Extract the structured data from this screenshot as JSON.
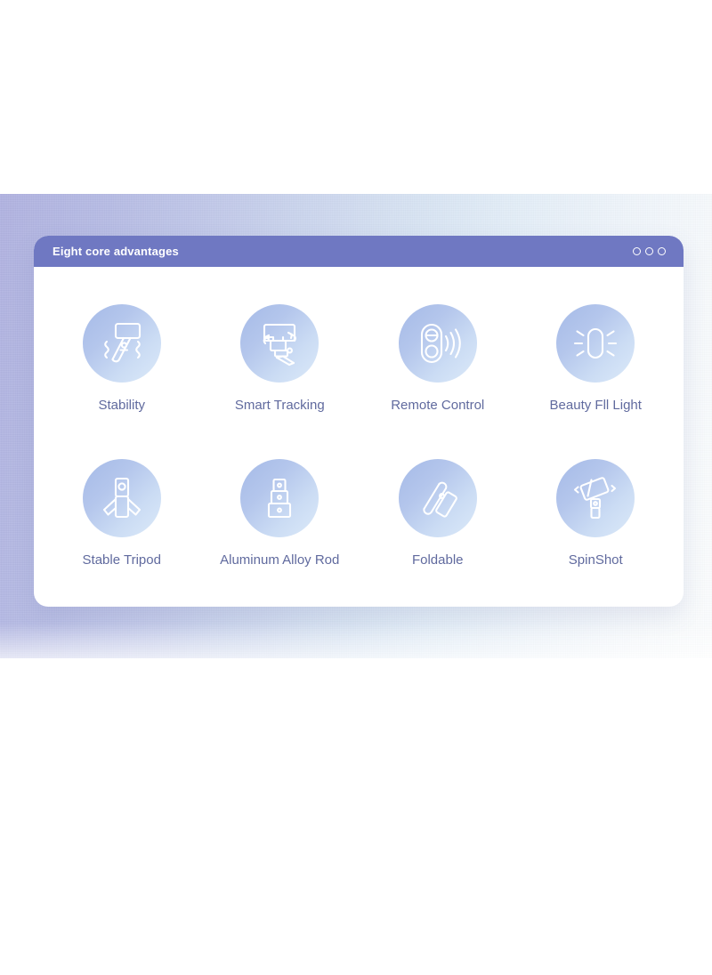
{
  "window": {
    "title": "Eight core advantages",
    "controls": [
      {
        "name": "window-dot-1"
      },
      {
        "name": "window-dot-2"
      },
      {
        "name": "window-dot-3"
      }
    ],
    "titlebar_color": "#6f78c2",
    "label_color": "#606a9e",
    "circle_gradient_from": "#a5bae7",
    "circle_gradient_to": "#dceaf9"
  },
  "features": [
    {
      "label": "Stability",
      "icon": "selfie-stick-vibration-icon"
    },
    {
      "label": "Smart Tracking",
      "icon": "gimbal-tracking-icon"
    },
    {
      "label": "Remote Control",
      "icon": "remote-signal-icon"
    },
    {
      "label": "Beauty Fll Light",
      "icon": "fill-light-icon"
    },
    {
      "label": "Stable Tripod",
      "icon": "tripod-icon"
    },
    {
      "label": "Aluminum Alloy Rod",
      "icon": "telescoping-rod-icon"
    },
    {
      "label": "Foldable",
      "icon": "foldable-arm-icon"
    },
    {
      "label": "SpinShot",
      "icon": "spin-shot-icon"
    }
  ]
}
